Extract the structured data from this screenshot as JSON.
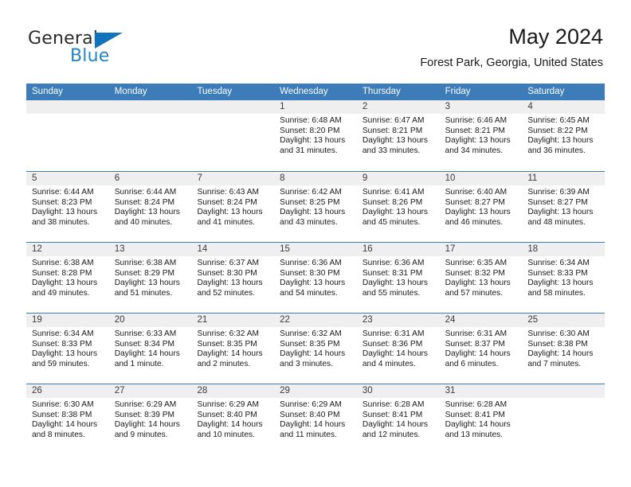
{
  "brand": {
    "name_top": "General",
    "name_bottom": "Blue",
    "accent_color": "#2484C6",
    "triangle_color": "#1273BD"
  },
  "header": {
    "title": "May 2024",
    "subtitle": "Forest Park, Georgia, United States"
  },
  "theme": {
    "header_blue": "#3B7CB9",
    "day_strip_gray": "#EFEFEF",
    "text_color": "#1a1a1a"
  },
  "weekdays": [
    "Sunday",
    "Monday",
    "Tuesday",
    "Wednesday",
    "Thursday",
    "Friday",
    "Saturday"
  ],
  "labels": {
    "sunrise_prefix": "Sunrise: ",
    "sunset_prefix": "Sunset: ",
    "daylight_prefix": "Daylight: "
  },
  "weeks": [
    [
      {
        "day": "",
        "empty": true
      },
      {
        "day": "",
        "empty": true
      },
      {
        "day": "",
        "empty": true
      },
      {
        "day": "1",
        "sunrise": "Sunrise: 6:48 AM",
        "sunset": "Sunset: 8:20 PM",
        "daylight_1": "Daylight: 13 hours",
        "daylight_2": "and 31 minutes."
      },
      {
        "day": "2",
        "sunrise": "Sunrise: 6:47 AM",
        "sunset": "Sunset: 8:21 PM",
        "daylight_1": "Daylight: 13 hours",
        "daylight_2": "and 33 minutes."
      },
      {
        "day": "3",
        "sunrise": "Sunrise: 6:46 AM",
        "sunset": "Sunset: 8:21 PM",
        "daylight_1": "Daylight: 13 hours",
        "daylight_2": "and 34 minutes."
      },
      {
        "day": "4",
        "sunrise": "Sunrise: 6:45 AM",
        "sunset": "Sunset: 8:22 PM",
        "daylight_1": "Daylight: 13 hours",
        "daylight_2": "and 36 minutes."
      }
    ],
    [
      {
        "day": "5",
        "sunrise": "Sunrise: 6:44 AM",
        "sunset": "Sunset: 8:23 PM",
        "daylight_1": "Daylight: 13 hours",
        "daylight_2": "and 38 minutes."
      },
      {
        "day": "6",
        "sunrise": "Sunrise: 6:44 AM",
        "sunset": "Sunset: 8:24 PM",
        "daylight_1": "Daylight: 13 hours",
        "daylight_2": "and 40 minutes."
      },
      {
        "day": "7",
        "sunrise": "Sunrise: 6:43 AM",
        "sunset": "Sunset: 8:24 PM",
        "daylight_1": "Daylight: 13 hours",
        "daylight_2": "and 41 minutes."
      },
      {
        "day": "8",
        "sunrise": "Sunrise: 6:42 AM",
        "sunset": "Sunset: 8:25 PM",
        "daylight_1": "Daylight: 13 hours",
        "daylight_2": "and 43 minutes."
      },
      {
        "day": "9",
        "sunrise": "Sunrise: 6:41 AM",
        "sunset": "Sunset: 8:26 PM",
        "daylight_1": "Daylight: 13 hours",
        "daylight_2": "and 45 minutes."
      },
      {
        "day": "10",
        "sunrise": "Sunrise: 6:40 AM",
        "sunset": "Sunset: 8:27 PM",
        "daylight_1": "Daylight: 13 hours",
        "daylight_2": "and 46 minutes."
      },
      {
        "day": "11",
        "sunrise": "Sunrise: 6:39 AM",
        "sunset": "Sunset: 8:27 PM",
        "daylight_1": "Daylight: 13 hours",
        "daylight_2": "and 48 minutes."
      }
    ],
    [
      {
        "day": "12",
        "sunrise": "Sunrise: 6:38 AM",
        "sunset": "Sunset: 8:28 PM",
        "daylight_1": "Daylight: 13 hours",
        "daylight_2": "and 49 minutes."
      },
      {
        "day": "13",
        "sunrise": "Sunrise: 6:38 AM",
        "sunset": "Sunset: 8:29 PM",
        "daylight_1": "Daylight: 13 hours",
        "daylight_2": "and 51 minutes."
      },
      {
        "day": "14",
        "sunrise": "Sunrise: 6:37 AM",
        "sunset": "Sunset: 8:30 PM",
        "daylight_1": "Daylight: 13 hours",
        "daylight_2": "and 52 minutes."
      },
      {
        "day": "15",
        "sunrise": "Sunrise: 6:36 AM",
        "sunset": "Sunset: 8:30 PM",
        "daylight_1": "Daylight: 13 hours",
        "daylight_2": "and 54 minutes."
      },
      {
        "day": "16",
        "sunrise": "Sunrise: 6:36 AM",
        "sunset": "Sunset: 8:31 PM",
        "daylight_1": "Daylight: 13 hours",
        "daylight_2": "and 55 minutes."
      },
      {
        "day": "17",
        "sunrise": "Sunrise: 6:35 AM",
        "sunset": "Sunset: 8:32 PM",
        "daylight_1": "Daylight: 13 hours",
        "daylight_2": "and 57 minutes."
      },
      {
        "day": "18",
        "sunrise": "Sunrise: 6:34 AM",
        "sunset": "Sunset: 8:33 PM",
        "daylight_1": "Daylight: 13 hours",
        "daylight_2": "and 58 minutes."
      }
    ],
    [
      {
        "day": "19",
        "sunrise": "Sunrise: 6:34 AM",
        "sunset": "Sunset: 8:33 PM",
        "daylight_1": "Daylight: 13 hours",
        "daylight_2": "and 59 minutes."
      },
      {
        "day": "20",
        "sunrise": "Sunrise: 6:33 AM",
        "sunset": "Sunset: 8:34 PM",
        "daylight_1": "Daylight: 14 hours",
        "daylight_2": "and 1 minute."
      },
      {
        "day": "21",
        "sunrise": "Sunrise: 6:32 AM",
        "sunset": "Sunset: 8:35 PM",
        "daylight_1": "Daylight: 14 hours",
        "daylight_2": "and 2 minutes."
      },
      {
        "day": "22",
        "sunrise": "Sunrise: 6:32 AM",
        "sunset": "Sunset: 8:35 PM",
        "daylight_1": "Daylight: 14 hours",
        "daylight_2": "and 3 minutes."
      },
      {
        "day": "23",
        "sunrise": "Sunrise: 6:31 AM",
        "sunset": "Sunset: 8:36 PM",
        "daylight_1": "Daylight: 14 hours",
        "daylight_2": "and 4 minutes."
      },
      {
        "day": "24",
        "sunrise": "Sunrise: 6:31 AM",
        "sunset": "Sunset: 8:37 PM",
        "daylight_1": "Daylight: 14 hours",
        "daylight_2": "and 6 minutes."
      },
      {
        "day": "25",
        "sunrise": "Sunrise: 6:30 AM",
        "sunset": "Sunset: 8:38 PM",
        "daylight_1": "Daylight: 14 hours",
        "daylight_2": "and 7 minutes."
      }
    ],
    [
      {
        "day": "26",
        "sunrise": "Sunrise: 6:30 AM",
        "sunset": "Sunset: 8:38 PM",
        "daylight_1": "Daylight: 14 hours",
        "daylight_2": "and 8 minutes."
      },
      {
        "day": "27",
        "sunrise": "Sunrise: 6:29 AM",
        "sunset": "Sunset: 8:39 PM",
        "daylight_1": "Daylight: 14 hours",
        "daylight_2": "and 9 minutes."
      },
      {
        "day": "28",
        "sunrise": "Sunrise: 6:29 AM",
        "sunset": "Sunset: 8:40 PM",
        "daylight_1": "Daylight: 14 hours",
        "daylight_2": "and 10 minutes."
      },
      {
        "day": "29",
        "sunrise": "Sunrise: 6:29 AM",
        "sunset": "Sunset: 8:40 PM",
        "daylight_1": "Daylight: 14 hours",
        "daylight_2": "and 11 minutes."
      },
      {
        "day": "30",
        "sunrise": "Sunrise: 6:28 AM",
        "sunset": "Sunset: 8:41 PM",
        "daylight_1": "Daylight: 14 hours",
        "daylight_2": "and 12 minutes."
      },
      {
        "day": "31",
        "sunrise": "Sunrise: 6:28 AM",
        "sunset": "Sunset: 8:41 PM",
        "daylight_1": "Daylight: 14 hours",
        "daylight_2": "and 13 minutes."
      },
      {
        "day": "",
        "empty": true
      }
    ]
  ]
}
